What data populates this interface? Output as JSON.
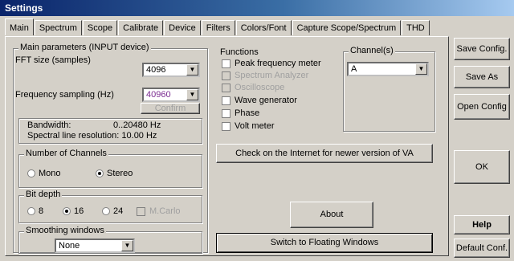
{
  "window": {
    "title": "Settings"
  },
  "tabs": [
    "Main",
    "Spectrum",
    "Scope",
    "Calibrate",
    "Device",
    "Filters",
    "Colors/Font",
    "Capture Scope/Spectrum",
    "THD"
  ],
  "main": {
    "params_label": "Main parameters (INPUT device)",
    "fft_label": "FFT size (samples)",
    "fft_value": "4096",
    "freq_label": "Frequency sampling (Hz)",
    "freq_value": "40960",
    "confirm_label": "Confirm",
    "bandwidth_label": "Bandwidth:",
    "bandwidth_value": "0..20480 Hz",
    "resolution_text": "Spectral line resolution: 10.00 Hz",
    "channels_label": "Number of Channels",
    "mono_label": "Mono",
    "stereo_label": "Stereo",
    "bitdepth_label": "Bit depth",
    "bit8": "8",
    "bit16": "16",
    "bit24": "24",
    "mcarlo": "M.Carlo",
    "smoothing_label": "Smoothing windows",
    "smoothing_value": "None"
  },
  "functions": {
    "label": "Functions",
    "items": [
      {
        "label": "Peak frequency meter",
        "enabled": true
      },
      {
        "label": "Spectrum Analyzer",
        "enabled": false
      },
      {
        "label": "Oscilloscope",
        "enabled": false
      },
      {
        "label": "Wave generator",
        "enabled": true
      },
      {
        "label": "Phase",
        "enabled": true
      },
      {
        "label": "Volt meter",
        "enabled": true
      }
    ]
  },
  "channels": {
    "label": "Channel(s)",
    "value": "A"
  },
  "buttons": {
    "check_update": "Check on the Internet for newer version of VA",
    "about": "About",
    "floating": "Switch to Floating Windows",
    "save_config": "Save Config.",
    "save_as": "Save As",
    "open_config": "Open Config",
    "ok": "OK",
    "help": "Help",
    "default_conf": "Default Conf."
  }
}
